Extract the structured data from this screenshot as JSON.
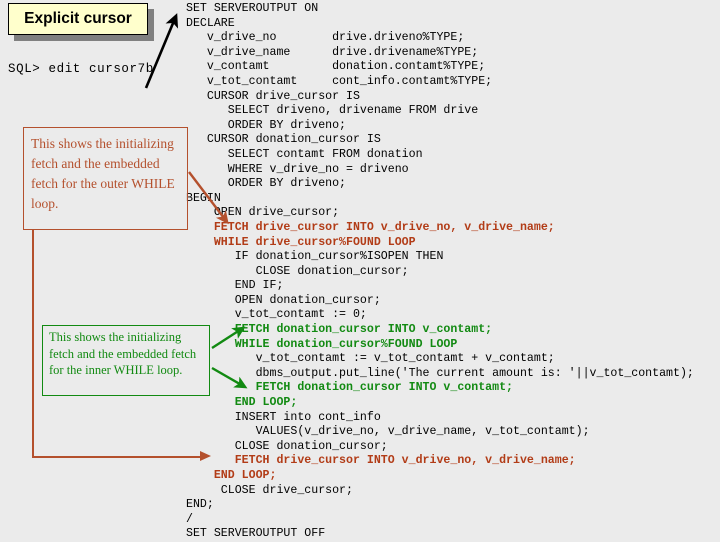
{
  "title": {
    "label": "Explicit cursor"
  },
  "prompt": {
    "text": "SQL> edit cursor7b"
  },
  "callouts": {
    "outer": {
      "text": "This shows the initializing fetch and the embedded fetch for the outer WHILE loop.",
      "color": "#b4502d"
    },
    "inner": {
      "text": "This shows the initializing fetch and the embedded fetch for the inner WHILE loop.",
      "color": "#128a12"
    }
  },
  "colors": {
    "background": "#ebebeb",
    "code_default": "#000000",
    "highlight_outer": "#b23c17",
    "highlight_inner": "#128a12",
    "title_fill": "#ffffcc",
    "title_shadow": "#808080"
  },
  "code": {
    "lines": [
      {
        "text": "SET SERVEROUTPUT ON",
        "style": "plain"
      },
      {
        "text": "DECLARE",
        "style": "plain"
      },
      {
        "text": "   v_drive_no        drive.driveno%TYPE;",
        "style": "plain"
      },
      {
        "text": "   v_drive_name      drive.drivename%TYPE;",
        "style": "plain"
      },
      {
        "text": "   v_contamt         donation.contamt%TYPE;",
        "style": "plain"
      },
      {
        "text": "   v_tot_contamt     cont_info.contamt%TYPE;",
        "style": "plain"
      },
      {
        "text": "   CURSOR drive_cursor IS",
        "style": "plain"
      },
      {
        "text": "      SELECT driveno, drivename FROM drive",
        "style": "plain"
      },
      {
        "text": "      ORDER BY driveno;",
        "style": "plain"
      },
      {
        "text": "   CURSOR donation_cursor IS",
        "style": "plain"
      },
      {
        "text": "      SELECT contamt FROM donation",
        "style": "plain"
      },
      {
        "text": "      WHERE v_drive_no = driveno",
        "style": "plain"
      },
      {
        "text": "      ORDER BY driveno;",
        "style": "plain"
      },
      {
        "text": "BEGIN",
        "style": "plain"
      },
      {
        "text": "    OPEN drive_cursor;",
        "style": "plain"
      },
      {
        "text": "    FETCH drive_cursor INTO v_drive_no, v_drive_name;",
        "style": "red"
      },
      {
        "text": "    WHILE drive_cursor%FOUND LOOP",
        "style": "red"
      },
      {
        "text": "       IF donation_cursor%ISOPEN THEN",
        "style": "plain"
      },
      {
        "text": "          CLOSE donation_cursor;",
        "style": "plain"
      },
      {
        "text": "       END IF;",
        "style": "plain"
      },
      {
        "text": "       OPEN donation_cursor;",
        "style": "plain"
      },
      {
        "text": "       v_tot_contamt := 0;",
        "style": "plain"
      },
      {
        "text": "       FETCH donation_cursor INTO v_contamt;",
        "style": "green"
      },
      {
        "text": "       WHILE donation_cursor%FOUND LOOP",
        "style": "green"
      },
      {
        "text": "          v_tot_contamt := v_tot_contamt + v_contamt;",
        "style": "plain"
      },
      {
        "text": "          dbms_output.put_line('The current amount is: '||v_tot_contamt);",
        "style": "plain"
      },
      {
        "text": "          FETCH donation_cursor INTO v_contamt;",
        "style": "green"
      },
      {
        "text": "       END LOOP;",
        "style": "green"
      },
      {
        "text": "       INSERT into cont_info",
        "style": "plain"
      },
      {
        "text": "          VALUES(v_drive_no, v_drive_name, v_tot_contamt);",
        "style": "plain"
      },
      {
        "text": "       CLOSE donation_cursor;",
        "style": "plain"
      },
      {
        "text": "       FETCH drive_cursor INTO v_drive_no, v_drive_name;",
        "style": "red"
      },
      {
        "text": "    END LOOP;",
        "style": "red"
      },
      {
        "text": "     CLOSE drive_cursor;",
        "style": "plain"
      },
      {
        "text": "END;",
        "style": "plain"
      },
      {
        "text": "/",
        "style": "plain"
      },
      {
        "text": "SET SERVEROUTPUT OFF",
        "style": "plain"
      }
    ]
  }
}
